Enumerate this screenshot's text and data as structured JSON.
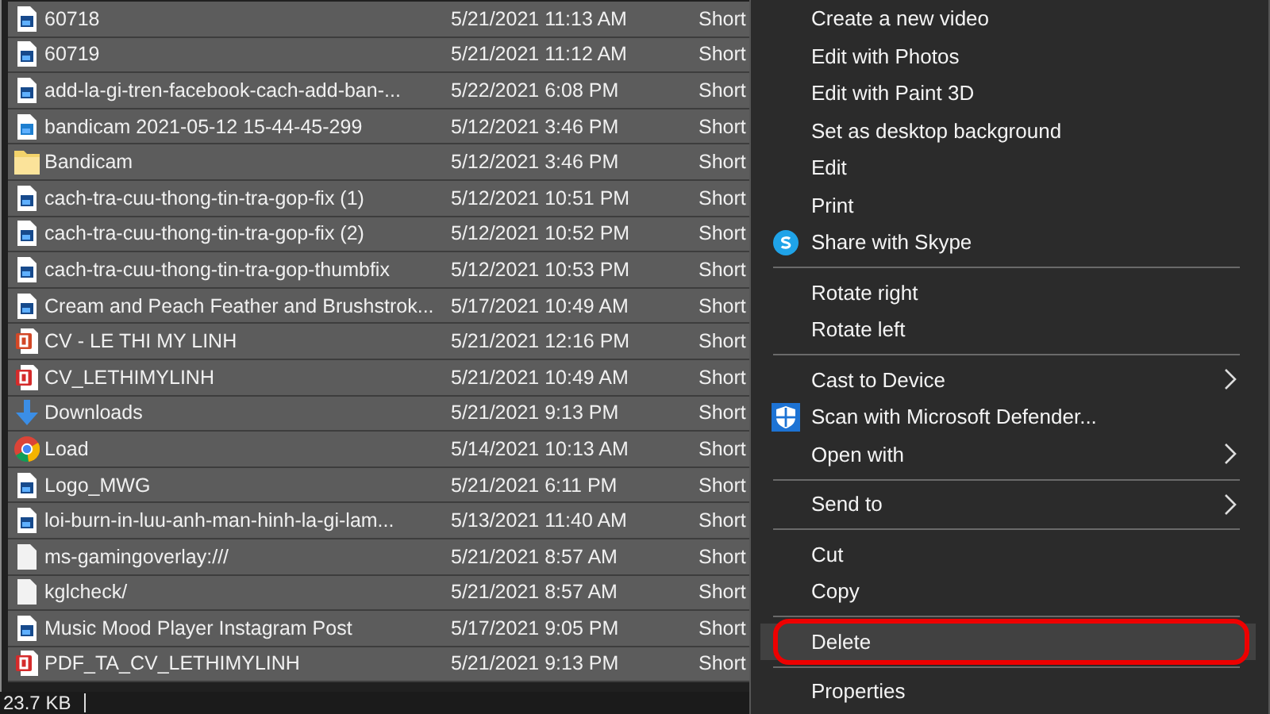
{
  "files": [
    {
      "name": "60718",
      "date": "5/21/2021 11:13 AM",
      "type": "Short",
      "kind": "image",
      "selected": true
    },
    {
      "name": "60719",
      "date": "5/21/2021 11:12 AM",
      "type": "Short",
      "kind": "image",
      "selected": true
    },
    {
      "name": "add-la-gi-tren-facebook-cach-add-ban-...",
      "date": "5/22/2021 6:08 PM",
      "type": "Short",
      "kind": "image",
      "selected": true
    },
    {
      "name": "bandicam 2021-05-12 15-44-45-299",
      "date": "5/12/2021 3:46 PM",
      "type": "Short",
      "kind": "photo",
      "selected": true
    },
    {
      "name": "Bandicam",
      "date": "5/12/2021 3:46 PM",
      "type": "Short",
      "kind": "folder",
      "selected": true
    },
    {
      "name": "cach-tra-cuu-thong-tin-tra-gop-fix (1)",
      "date": "5/12/2021 10:51 PM",
      "type": "Short",
      "kind": "image",
      "selected": true
    },
    {
      "name": "cach-tra-cuu-thong-tin-tra-gop-fix (2)",
      "date": "5/12/2021 10:52 PM",
      "type": "Short",
      "kind": "image",
      "selected": true
    },
    {
      "name": "cach-tra-cuu-thong-tin-tra-gop-thumbfix",
      "date": "5/12/2021 10:53 PM",
      "type": "Short",
      "kind": "image",
      "selected": true
    },
    {
      "name": "Cream and Peach Feather and Brushstrok...",
      "date": "5/17/2021 10:49 AM",
      "type": "Short",
      "kind": "image",
      "selected": true
    },
    {
      "name": "CV - LE THI MY LINH",
      "date": "5/21/2021 12:16 PM",
      "type": "Short",
      "kind": "slides",
      "selected": true
    },
    {
      "name": "CV_LETHIMYLINH",
      "date": "5/21/2021 10:49 AM",
      "type": "Short",
      "kind": "pdf",
      "selected": true
    },
    {
      "name": "Downloads",
      "date": "5/21/2021 9:13 PM",
      "type": "Short",
      "kind": "download",
      "selected": true
    },
    {
      "name": "Load",
      "date": "5/14/2021 10:13 AM",
      "type": "Short",
      "kind": "browser",
      "selected": true
    },
    {
      "name": "Logo_MWG",
      "date": "5/21/2021 6:11 PM",
      "type": "Short",
      "kind": "image",
      "selected": true
    },
    {
      "name": "loi-burn-in-luu-anh-man-hinh-la-gi-lam...",
      "date": "5/13/2021 11:40 AM",
      "type": "Short",
      "kind": "image",
      "selected": true
    },
    {
      "name": "ms-gamingoverlay:///",
      "date": "5/21/2021 8:57 AM",
      "type": "Short",
      "kind": "blank",
      "selected": true
    },
    {
      "name": "kglcheck/",
      "date": "5/21/2021 8:57 AM",
      "type": "Short",
      "kind": "blank",
      "selected": true
    },
    {
      "name": "Music Mood Player Instagram Post",
      "date": "5/17/2021 9:05 PM",
      "type": "Short",
      "kind": "image",
      "selected": true
    },
    {
      "name": "PDF_TA_CV_LETHIMYLINH",
      "date": "5/21/2021 9:13 PM",
      "type": "Short",
      "kind": "pdf",
      "selected": true
    }
  ],
  "status_bar": {
    "size": "23.7 KB"
  },
  "context_menu": [
    {
      "kind": "plain",
      "label": "Create a new video",
      "selected": false
    },
    {
      "kind": "plain",
      "label": "Edit with Photos",
      "selected": false
    },
    {
      "kind": "plain",
      "label": "Edit with Paint 3D",
      "selected": false
    },
    {
      "kind": "plain",
      "label": "Set as desktop background",
      "selected": false
    },
    {
      "kind": "plain",
      "label": "Edit",
      "selected": false
    },
    {
      "kind": "plain",
      "label": "Print",
      "selected": false
    },
    {
      "kind": "skype",
      "label": "Share with Skype",
      "selected": false
    },
    {
      "kind": "separator"
    },
    {
      "kind": "plain",
      "label": "Rotate right",
      "selected": false
    },
    {
      "kind": "plain",
      "label": "Rotate left",
      "selected": false
    },
    {
      "kind": "separator"
    },
    {
      "kind": "plain",
      "label": "Cast to Device",
      "submenu": true,
      "selected": false
    },
    {
      "kind": "shield",
      "label": "Scan with Microsoft Defender...",
      "selected": false
    },
    {
      "kind": "plain",
      "label": "Open with",
      "submenu": true,
      "selected": false
    },
    {
      "kind": "separator"
    },
    {
      "kind": "plain",
      "label": "Send to",
      "submenu": true,
      "selected": false
    },
    {
      "kind": "separator"
    },
    {
      "kind": "plain",
      "label": "Cut",
      "selected": false
    },
    {
      "kind": "plain",
      "label": "Copy",
      "selected": false
    },
    {
      "kind": "separator"
    },
    {
      "kind": "plain",
      "label": "Delete",
      "selected": true,
      "circled": true
    },
    {
      "kind": "separator"
    },
    {
      "kind": "plain",
      "label": "Properties",
      "selected": false
    }
  ]
}
